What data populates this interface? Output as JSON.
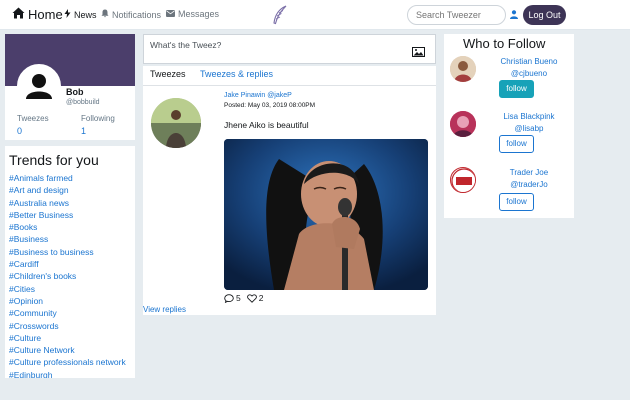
{
  "nav": {
    "home_label": "Home",
    "news_label": "News",
    "notifications_label": "Notifications",
    "messages_label": "Messages",
    "search_placeholder": "Search Tweezer",
    "logout_label": "Log Out"
  },
  "profile": {
    "name": "Bob",
    "handle": "@bobbuild",
    "tweezes_label": "Tweezes",
    "tweezes_count": "0",
    "following_label": "Following",
    "following_count": "1"
  },
  "trends": {
    "title": "Trends for you",
    "tags": [
      "#Animals farmed",
      "#Art and design",
      "#Australia news",
      "#Better Business",
      "#Books",
      "#Business",
      "#Business to business",
      "#Cardiff",
      "#Children's books",
      "#Cities",
      "#Opinion",
      "#Community",
      "#Crosswords",
      "#Culture",
      "#Culture Network",
      "#Culture professionals network",
      "#Edinburgh"
    ]
  },
  "compose": {
    "placeholder": "What's the Tweez?"
  },
  "tabs": {
    "tweezes": "Tweezes",
    "replies": "Tweezes & replies"
  },
  "tweet": {
    "author": "Jake Pinawin @jakeP",
    "posted": "Posted: May 03, 2019 08:00PM",
    "text": "Jhene Aiko is beautiful",
    "reply_count": "5",
    "like_count": "2",
    "view_replies": "View replies"
  },
  "who_to_follow": {
    "title": "Who to Follow",
    "people": [
      {
        "name": "Christian Bueno",
        "handle": "@cjbueno",
        "button": "follow"
      },
      {
        "name": "Lisa Blackpink",
        "handle": "@lisabp",
        "button": "follow"
      },
      {
        "name": "Trader Joe",
        "handle": "@traderJo",
        "button": "follow"
      }
    ]
  },
  "colors": {
    "accent": "#1b75d0",
    "logout_bg": "#3d3456",
    "banner": "#4b3e6b",
    "hover_follow": "#17a2b8"
  },
  "icons": [
    "home-icon",
    "bolt-icon",
    "bell-icon",
    "envelope-icon",
    "feather-logo-icon",
    "user-icon",
    "image-icon",
    "comment-icon",
    "heart-icon"
  ]
}
